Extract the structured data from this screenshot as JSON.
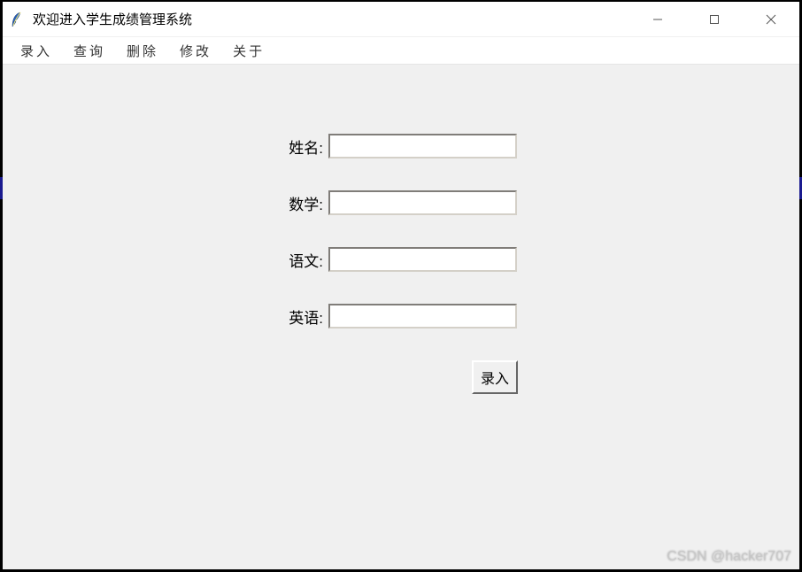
{
  "window": {
    "title": "欢迎进入学生成绩管理系统"
  },
  "menu": {
    "items": [
      "录入",
      "查询",
      "删除",
      "修改",
      "关于"
    ]
  },
  "form": {
    "fields": [
      {
        "label": "姓名:",
        "value": ""
      },
      {
        "label": "数学:",
        "value": ""
      },
      {
        "label": "语文:",
        "value": ""
      },
      {
        "label": "英语:",
        "value": ""
      }
    ],
    "submit_label": "录入"
  },
  "watermark": "CSDN @hacker707"
}
